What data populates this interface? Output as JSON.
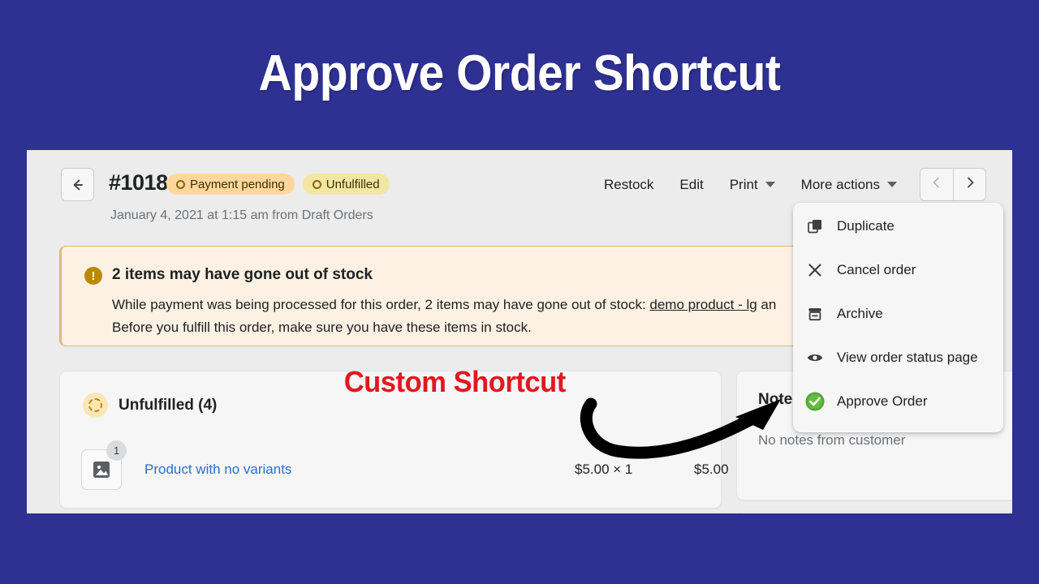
{
  "promo": {
    "title": "Approve Order Shortcut",
    "annotation": "Custom Shortcut",
    "title_color": "#FFFFFF",
    "background_color": "#2E3192",
    "annotation_color": "#E2181F"
  },
  "order": {
    "back_icon": "back-arrow-icon",
    "number": "#1018",
    "badges": [
      {
        "label": "Payment pending",
        "color": "#FFD79D"
      },
      {
        "label": "Unfulfilled",
        "color": "#F2E6A3"
      }
    ],
    "date_line": "January 4, 2021 at 1:15 am from Draft Orders"
  },
  "header_actions": {
    "restock": "Restock",
    "edit": "Edit",
    "print": "Print",
    "more_actions": "More actions",
    "prev_icon": "chevron-left-icon",
    "next_icon": "chevron-right-icon"
  },
  "banner": {
    "icon": "warning-icon",
    "title": "2 items may have gone out of stock",
    "body_before_link": "While payment was being processed for this order, 2 items may have gone out of stock: ",
    "link_text": "demo product - lg",
    "body_after_link": " an",
    "body_line2": "Before you fulfill this order, make sure you have these items in stock."
  },
  "fulfillment_card": {
    "status_icon": "dashed-circle-icon",
    "title": "Unfulfilled (4)",
    "item": {
      "thumbnail_icon": "image-placeholder-icon",
      "quantity_badge": "1",
      "name": "Product with no variants",
      "unit_price": "$5.00 × 1",
      "total_price": "$5.00"
    }
  },
  "notes_card": {
    "title": "Notes",
    "body": "No notes from customer"
  },
  "more_actions_menu": {
    "items": [
      {
        "label": "Duplicate",
        "icon": "duplicate-icon"
      },
      {
        "label": "Cancel order",
        "icon": "close-x-icon"
      },
      {
        "label": "Archive",
        "icon": "archive-icon"
      },
      {
        "label": "View order status page",
        "icon": "eye-icon"
      },
      {
        "label": "Approve Order",
        "icon": "green-check-circle-icon"
      }
    ]
  }
}
